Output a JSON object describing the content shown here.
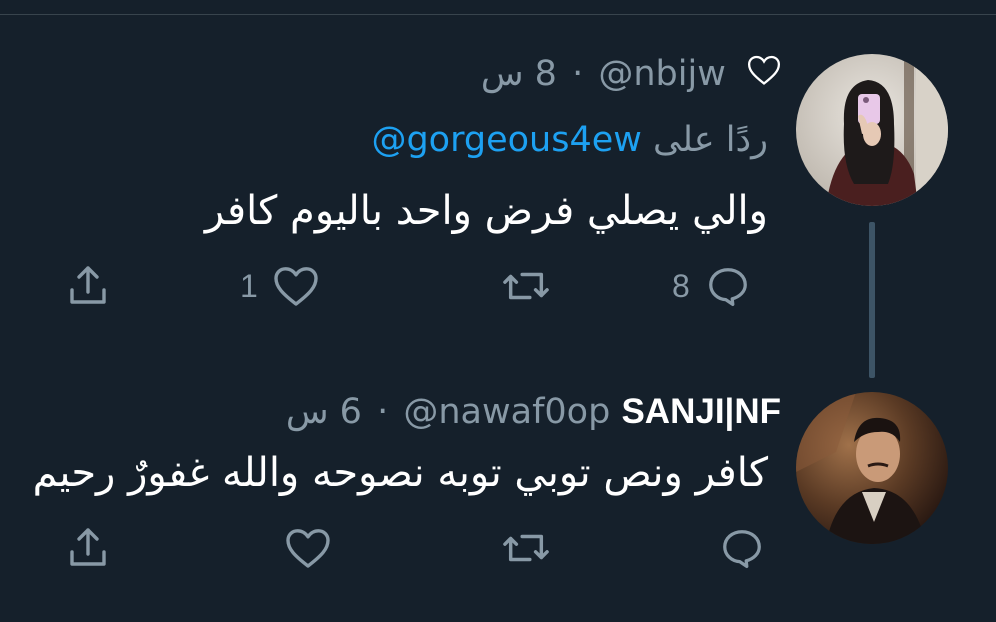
{
  "colors": {
    "background": "#15202b",
    "text_primary": "#ffffff",
    "text_secondary": "#8899a6",
    "link": "#1da1f2",
    "thread_line": "#3d5466",
    "divider": "#38444d"
  },
  "tweets": [
    {
      "display_name": "",
      "handle": "@nbijw",
      "separator": "·",
      "time": "8 س",
      "reply_prefix": "ردًا على",
      "reply_mention": "@gorgeous4ew",
      "text": "والي يصلي فرض واحد باليوم كافر",
      "reply_count": "8",
      "like_count": "1",
      "avatar_icon": "avatar-photo",
      "header_icon": "heart-outline-icon"
    },
    {
      "display_name": "SANJI|NF",
      "handle": "@nawaf0op",
      "separator": "·",
      "time": "6 س",
      "text": "كافر ونص توبي توبه نصوحه والله غفورٌ رحيم",
      "reply_count": "",
      "like_count": "",
      "avatar_icon": "avatar-photo"
    }
  ],
  "action_icons": [
    "reply-icon",
    "retweet-icon",
    "like-icon",
    "share-icon"
  ]
}
